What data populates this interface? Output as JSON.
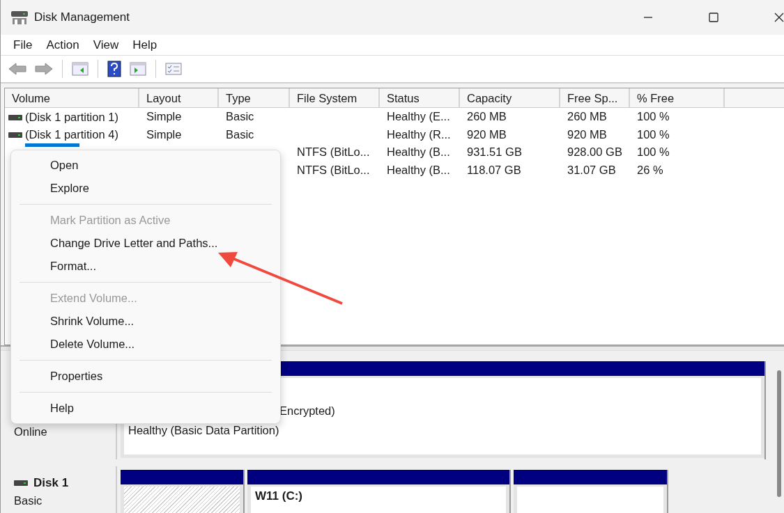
{
  "window": {
    "title": "Disk Management"
  },
  "menu": [
    {
      "label": "File"
    },
    {
      "label": "Action"
    },
    {
      "label": "View"
    },
    {
      "label": "Help"
    }
  ],
  "table": {
    "columns": [
      "Volume",
      "Layout",
      "Type",
      "File System",
      "Status",
      "Capacity",
      "Free Sp...",
      "% Free"
    ],
    "rows": [
      {
        "selected": false,
        "cells": [
          "(Disk 1 partition 1)",
          "Simple",
          "Basic",
          "",
          "Healthy (E...",
          "260 MB",
          "260 MB",
          "100 %"
        ]
      },
      {
        "selected": false,
        "cells": [
          "(Disk 1 partition 4)",
          "Simple",
          "Basic",
          "",
          "Healthy (R...",
          "920 MB",
          "920 MB",
          "100 %"
        ]
      },
      {
        "selected": true,
        "cells": [
          "",
          "",
          "",
          "NTFS (BitLo...",
          "Healthy (B...",
          "931.51 GB",
          "928.00 GB",
          "100 %"
        ]
      },
      {
        "selected": false,
        "cells": [
          "",
          "",
          "",
          "NTFS (BitLo...",
          "Healthy (B...",
          "118.07 GB",
          "31.07 GB",
          "26 %"
        ]
      }
    ]
  },
  "context_menu": [
    {
      "kind": "item",
      "label": "Open",
      "disabled": false
    },
    {
      "kind": "item",
      "label": "Explore",
      "disabled": false
    },
    {
      "kind": "separator"
    },
    {
      "kind": "item",
      "label": "Mark Partition as Active",
      "disabled": true
    },
    {
      "kind": "item",
      "label": "Change Drive Letter and Paths...",
      "disabled": false
    },
    {
      "kind": "item",
      "label": "Format...",
      "disabled": false
    },
    {
      "kind": "separator"
    },
    {
      "kind": "item",
      "label": "Extend Volume...",
      "disabled": true
    },
    {
      "kind": "item",
      "label": "Shrink Volume...",
      "disabled": false
    },
    {
      "kind": "item",
      "label": "Delete Volume...",
      "disabled": false
    },
    {
      "kind": "separator"
    },
    {
      "kind": "item",
      "label": "Properties",
      "disabled": false
    },
    {
      "kind": "separator"
    },
    {
      "kind": "item",
      "label": "Help",
      "disabled": false
    }
  ],
  "disks": [
    {
      "status": "Online",
      "partitions": [
        {
          "selected": false,
          "lines": [
            "Encrypted)",
            "Healthy (Basic Data Partition)"
          ]
        }
      ]
    },
    {
      "name": "Disk 1",
      "type": "Basic",
      "partitions": [
        {
          "selected": true
        },
        {
          "selected": false,
          "label": "W11  (C:)"
        },
        {
          "selected": false
        }
      ]
    }
  ]
}
